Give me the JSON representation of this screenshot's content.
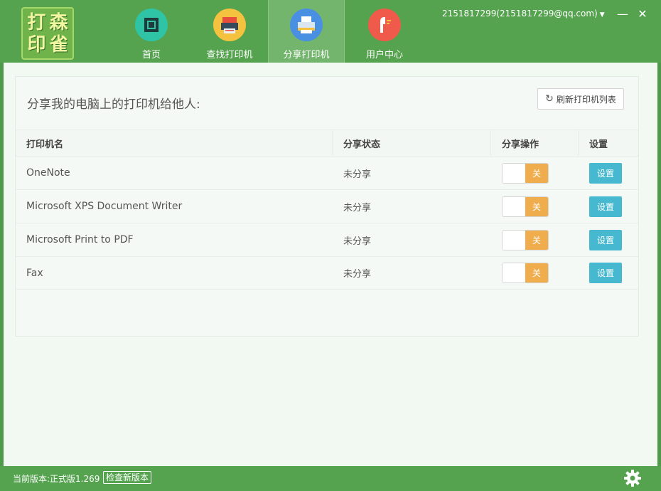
{
  "app": {
    "logo_chars": [
      "打",
      "森",
      "印",
      "雀"
    ]
  },
  "nav": [
    {
      "label": "首页",
      "icon": "home-icon",
      "color": "#2ec4a5"
    },
    {
      "label": "查找打印机",
      "icon": "find-printer-icon",
      "color": "#f4c23f"
    },
    {
      "label": "分享打印机",
      "icon": "share-printer-icon",
      "color": "#4a90e2",
      "active": true
    },
    {
      "label": "用户中心",
      "icon": "user-center-icon",
      "color": "#ef5a4a"
    }
  ],
  "user": {
    "account": "2151817299(2151817299@qq.com)"
  },
  "window": {
    "minimize": "—",
    "close": "✕"
  },
  "panel": {
    "title": "分享我的电脑上的打印机给他人:",
    "refresh_label": "刷新打印机列表"
  },
  "table": {
    "headers": [
      "打印机名",
      "分享状态",
      "分享操作",
      "设置"
    ],
    "rows": [
      {
        "name": "OneNote",
        "status": "未分享",
        "toggle": "关",
        "action": "设置"
      },
      {
        "name": "Microsoft XPS Document Writer",
        "status": "未分享",
        "toggle": "关",
        "action": "设置"
      },
      {
        "name": "Microsoft Print to PDF",
        "status": "未分享",
        "toggle": "关",
        "action": "设置"
      },
      {
        "name": "Fax",
        "status": "未分享",
        "toggle": "关",
        "action": "设置"
      }
    ]
  },
  "statusbar": {
    "version": "当前版本:正式版1.269",
    "check_label": "检查新版本"
  },
  "colors": {
    "brand_green": "#55a34f",
    "toggle_off": "#f0ad4e",
    "settings_button": "#46b8cf"
  }
}
